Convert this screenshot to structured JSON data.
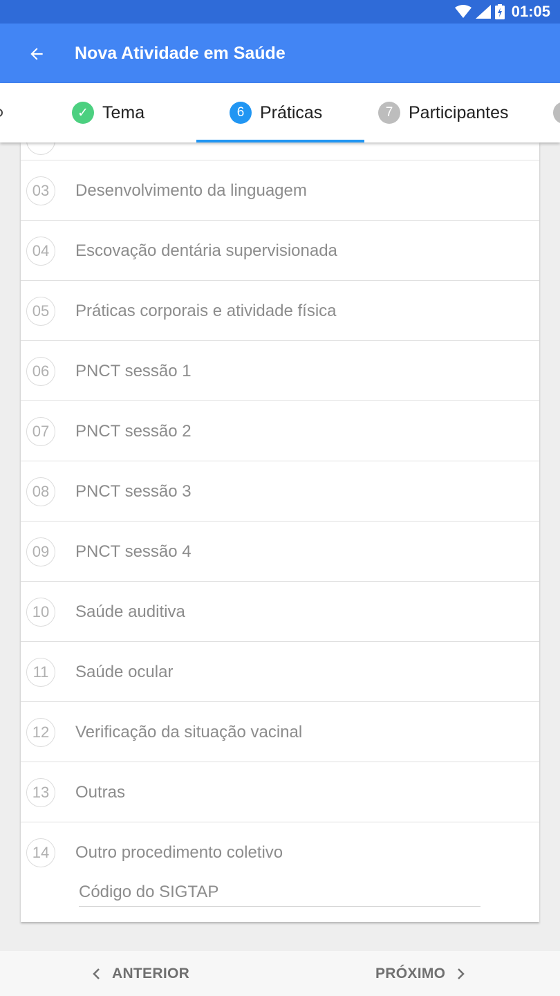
{
  "status_bar": {
    "time": "01:05"
  },
  "app_bar": {
    "title": "Nova Atividade em Saúde"
  },
  "tabs": [
    {
      "label": "Tema",
      "badge": "✓",
      "state": "done",
      "color": "#4cd080"
    },
    {
      "label": "Práticas",
      "badge": "6",
      "state": "active",
      "color": "#2196f3"
    },
    {
      "label": "Participantes",
      "badge": "7",
      "state": "pending",
      "color": "#bdbdbd"
    }
  ],
  "practices": [
    {
      "number": "03",
      "label": "Desenvolvimento da linguagem"
    },
    {
      "number": "04",
      "label": "Escovação dentária supervisionada"
    },
    {
      "number": "05",
      "label": "Práticas corporais e atividade física"
    },
    {
      "number": "06",
      "label": "PNCT sessão 1"
    },
    {
      "number": "07",
      "label": "PNCT sessão 2"
    },
    {
      "number": "08",
      "label": "PNCT sessão 3"
    },
    {
      "number": "09",
      "label": "PNCT sessão 4"
    },
    {
      "number": "10",
      "label": "Saúde auditiva"
    },
    {
      "number": "11",
      "label": "Saúde ocular"
    },
    {
      "number": "12",
      "label": "Verificação da situação vacinal"
    },
    {
      "number": "13",
      "label": "Outras"
    },
    {
      "number": "14",
      "label": "Outro procedimento coletivo"
    }
  ],
  "sigtap_field": {
    "placeholder": "Código do SIGTAP",
    "value": ""
  },
  "bottom_nav": {
    "previous_label": "ANTERIOR",
    "next_label": "PRÓXIMO"
  },
  "colors": {
    "status_bar": "#2f6bd8",
    "app_bar": "#4285f4",
    "accent": "#2196f3",
    "done": "#4cd080",
    "pending": "#bdbdbd"
  }
}
